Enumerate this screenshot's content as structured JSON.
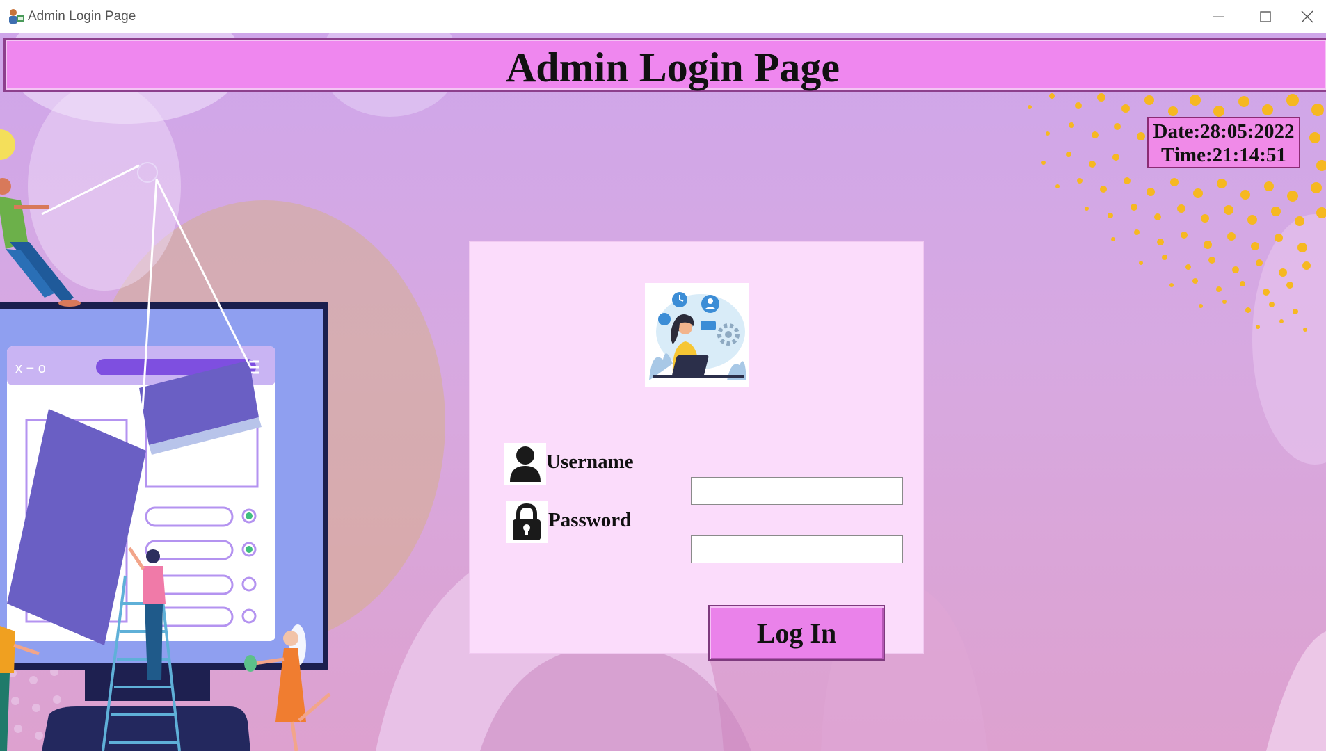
{
  "window": {
    "title": "Admin Login Page",
    "app_icon": "admin-app-icon",
    "controls": [
      "minimize-icon",
      "maximize-icon",
      "close-icon"
    ]
  },
  "header": {
    "title": "Admin Login Page"
  },
  "datetime": {
    "date": "Date:28:05:2022",
    "time": "Time:21:14:51"
  },
  "login": {
    "illustration": "support-agent-illustration",
    "username": {
      "label": "Username",
      "value": "",
      "icon": "user-icon"
    },
    "password": {
      "label": "Password",
      "value": "",
      "icon": "lock-icon"
    },
    "button_label": "Log In"
  },
  "colors": {
    "banner": "#ef87ef",
    "panel": "#fbdcfb",
    "button": "#ea82ea",
    "background": "#d7a9e1"
  }
}
